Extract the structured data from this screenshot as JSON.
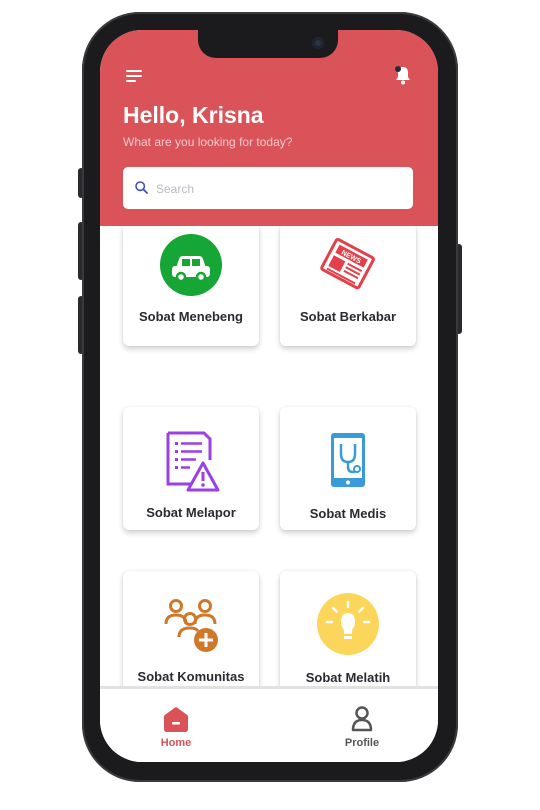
{
  "header": {
    "greeting": "Hello, Krisna",
    "subtitle": "What are you looking for today?",
    "background_color": "#d95358"
  },
  "search": {
    "placeholder": "Search",
    "value": ""
  },
  "menu": [
    {
      "label": "Sobat Menebeng",
      "icon": "car-icon",
      "color": "#16a636"
    },
    {
      "label": "Sobat Berkabar",
      "icon": "newspaper-icon",
      "color": "#e4404a"
    },
    {
      "label": "Sobat Melapor",
      "icon": "report-warning-icon",
      "color": "#9b3fe8"
    },
    {
      "label": "Sobat Medis",
      "icon": "medical-tablet-icon",
      "color": "#3b9ad9"
    },
    {
      "label": "Sobat Komunitas",
      "icon": "community-add-icon",
      "color": "#d0782a"
    },
    {
      "label": "Sobat Melatih",
      "icon": "lightbulb-icon",
      "color": "#fbd65a"
    }
  ],
  "bottom_nav": {
    "items": [
      {
        "label": "Home",
        "icon": "home-icon",
        "active": true,
        "color": "#d95358"
      },
      {
        "label": "Profile",
        "icon": "profile-icon",
        "active": false,
        "color": "#555555"
      }
    ]
  }
}
